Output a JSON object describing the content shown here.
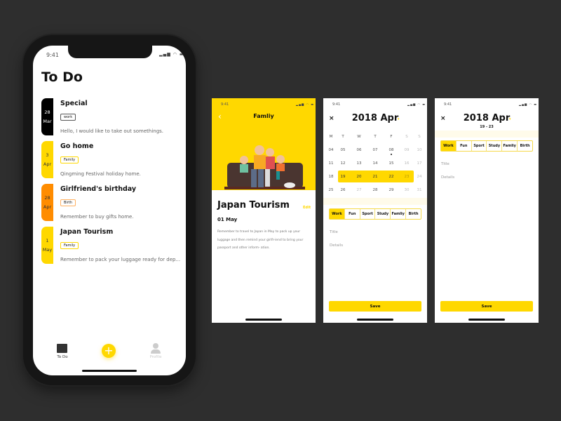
{
  "colors": {
    "accent": "#ffd800",
    "black": "#000000",
    "orange": "#ff8c00"
  },
  "status": {
    "time": "9:41"
  },
  "todo": {
    "title": "To Do",
    "items": [
      {
        "day": "28",
        "month": "Mar",
        "title": "Special",
        "tag": "work",
        "desc": "Hello, I would like to take out somethings.",
        "color": "#000000",
        "text_color": "#ffffff",
        "tag_color": "#555555"
      },
      {
        "day": "3",
        "month": "Apr",
        "title": "Go home",
        "tag": "Family",
        "desc": "Qingming Festival holiday home.",
        "color": "#ffd800",
        "text_color": "#333333",
        "tag_color": "#ffd800"
      },
      {
        "day": "28",
        "month": "Apr",
        "title": "Girlfriend's birthday",
        "tag": "Birth",
        "desc": "Remember to buy gifts home.",
        "color": "#ff8c00",
        "text_color": "#333333",
        "tag_color": "#ffb060"
      },
      {
        "day": "1",
        "month": "May",
        "title": "Japan Tourism",
        "tag": "Family",
        "desc": "Remember to pack your luggage ready for dep...",
        "color": "#ffd800",
        "text_color": "#333333",
        "tag_color": "#ffd800"
      }
    ],
    "tabs": [
      {
        "label": "To Do",
        "icon": "folder-icon"
      },
      {
        "label": "",
        "icon": "plus-icon"
      },
      {
        "label": "Profile",
        "icon": "profile-icon"
      }
    ]
  },
  "detail": {
    "header": "Famliy",
    "title": "Japan Tourism",
    "edit": "Edit",
    "date": "01 May",
    "desc": [
      "Remember to travel to Japan in May to pack up your",
      "luggage and then remind your girlfr-iend to bring your",
      "passport and other inform- ation."
    ]
  },
  "calendar": {
    "title": "2018 Apr",
    "range": "19 - 23",
    "weekdays": [
      "M",
      "T",
      "W",
      "T",
      "F",
      "S",
      "S"
    ],
    "weeks": [
      [
        "04",
        "05",
        "06",
        "07",
        "08",
        "09",
        "10"
      ],
      [
        "11",
        "12",
        "13",
        "14",
        "15",
        "16",
        "17"
      ],
      [
        "18",
        "19",
        "20",
        "21",
        "22",
        "23",
        "24"
      ],
      [
        "25",
        "26",
        "27",
        "28",
        "29",
        "30",
        "31"
      ]
    ],
    "selected": [
      "19",
      "20",
      "21",
      "22",
      "23"
    ],
    "marked": "08",
    "categories": [
      "Work",
      "Fun",
      "Sport",
      "Study",
      "Famliy",
      "Birth"
    ],
    "active_category": "Work",
    "title_placeholder": "Title",
    "details_placeholder": "Details",
    "save": "Save"
  }
}
